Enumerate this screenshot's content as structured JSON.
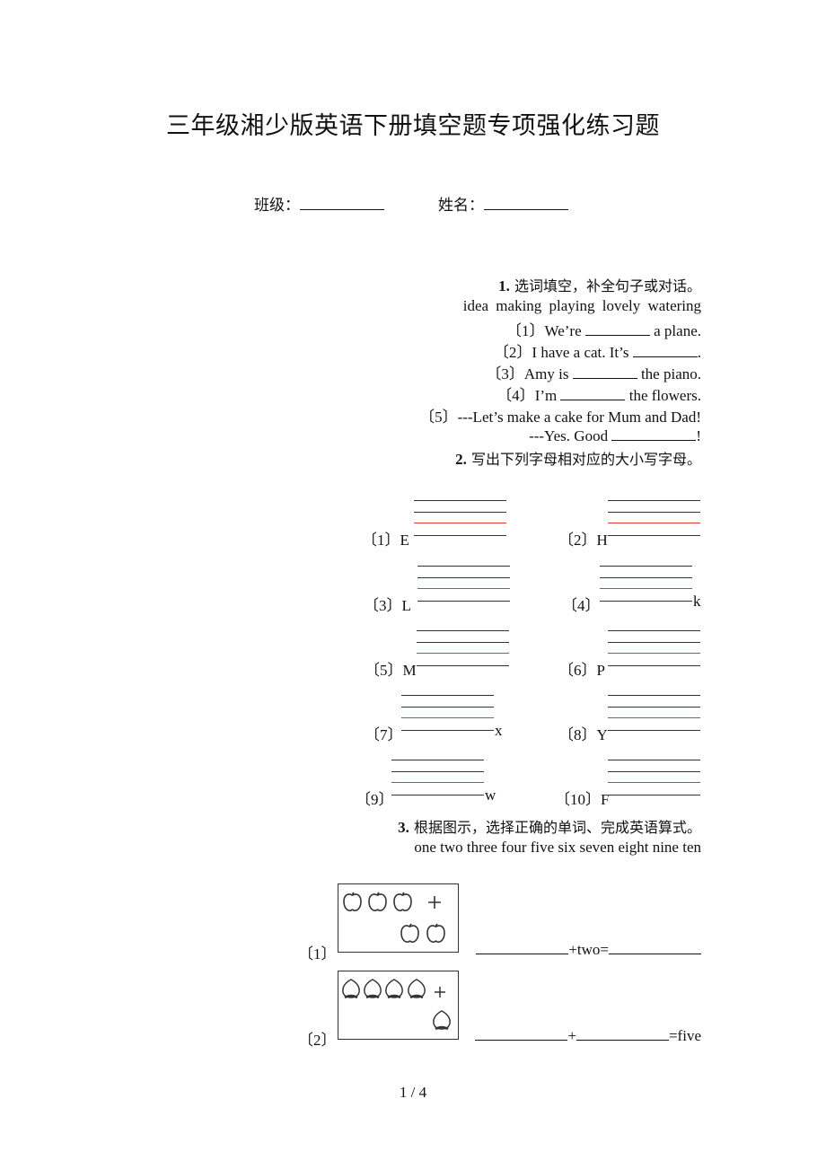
{
  "title": "三年级湘少版英语下册填空题专项强化练习题",
  "fields": {
    "class_label": "班级：",
    "name_label": "姓名："
  },
  "q1": {
    "number": "1.",
    "instruction": "选词填空，补全句子或对话。",
    "word_bank": "idea  making  playing  lovely  watering",
    "items": [
      {
        "idx": "〔1〕",
        "before": "We’re ",
        "after": " a plane."
      },
      {
        "idx": "〔2〕",
        "before": "I have a cat. It’s ",
        "after": "."
      },
      {
        "idx": "〔3〕",
        "before": "Amy is ",
        "after": " the piano."
      },
      {
        "idx": "〔4〕",
        "before": "I’m ",
        "after": " the flowers."
      },
      {
        "idx": "〔5〕",
        "before": "---Let’s make a cake for Mum and Dad!",
        "after": ""
      },
      {
        "idx": "",
        "before": "---Yes. Good ",
        "after": "!"
      }
    ]
  },
  "q2": {
    "number": "2.",
    "instruction": "写出下列字母相对应的大小写字母。",
    "items": [
      {
        "idx": "〔1〕",
        "letter_before": "E",
        "letter_after": ""
      },
      {
        "idx": "〔2〕",
        "letter_before": "H",
        "letter_after": ""
      },
      {
        "idx": "〔3〕",
        "letter_before": "L",
        "letter_after": ""
      },
      {
        "idx": "〔4〕",
        "letter_before": "",
        "letter_after": "k"
      },
      {
        "idx": "〔5〕",
        "letter_before": "M",
        "letter_after": ""
      },
      {
        "idx": "〔6〕",
        "letter_before": "P",
        "letter_after": ""
      },
      {
        "idx": "〔7〕",
        "letter_before": "",
        "letter_after": "x"
      },
      {
        "idx": "〔8〕",
        "letter_before": "Y",
        "letter_after": ""
      },
      {
        "idx": "〔9〕",
        "letter_before": "",
        "letter_after": "w"
      },
      {
        "idx": "〔10〕",
        "letter_before": "F",
        "letter_after": ""
      }
    ]
  },
  "q3": {
    "number": "3.",
    "instruction": "根据图示，选择正确的单词、完成英语算式。",
    "word_bank": "one two three four five six seven eight nine ten",
    "items": [
      {
        "idx": "〔1〕",
        "picture": "3 apples + 2 apples",
        "plus": "+two=",
        "result": ""
      },
      {
        "idx": "〔2〕",
        "picture": "4 peaches + 1 peach",
        "plus": "+",
        "result": "=five"
      }
    ],
    "plus_sign": "+"
  },
  "page": "1 / 4"
}
